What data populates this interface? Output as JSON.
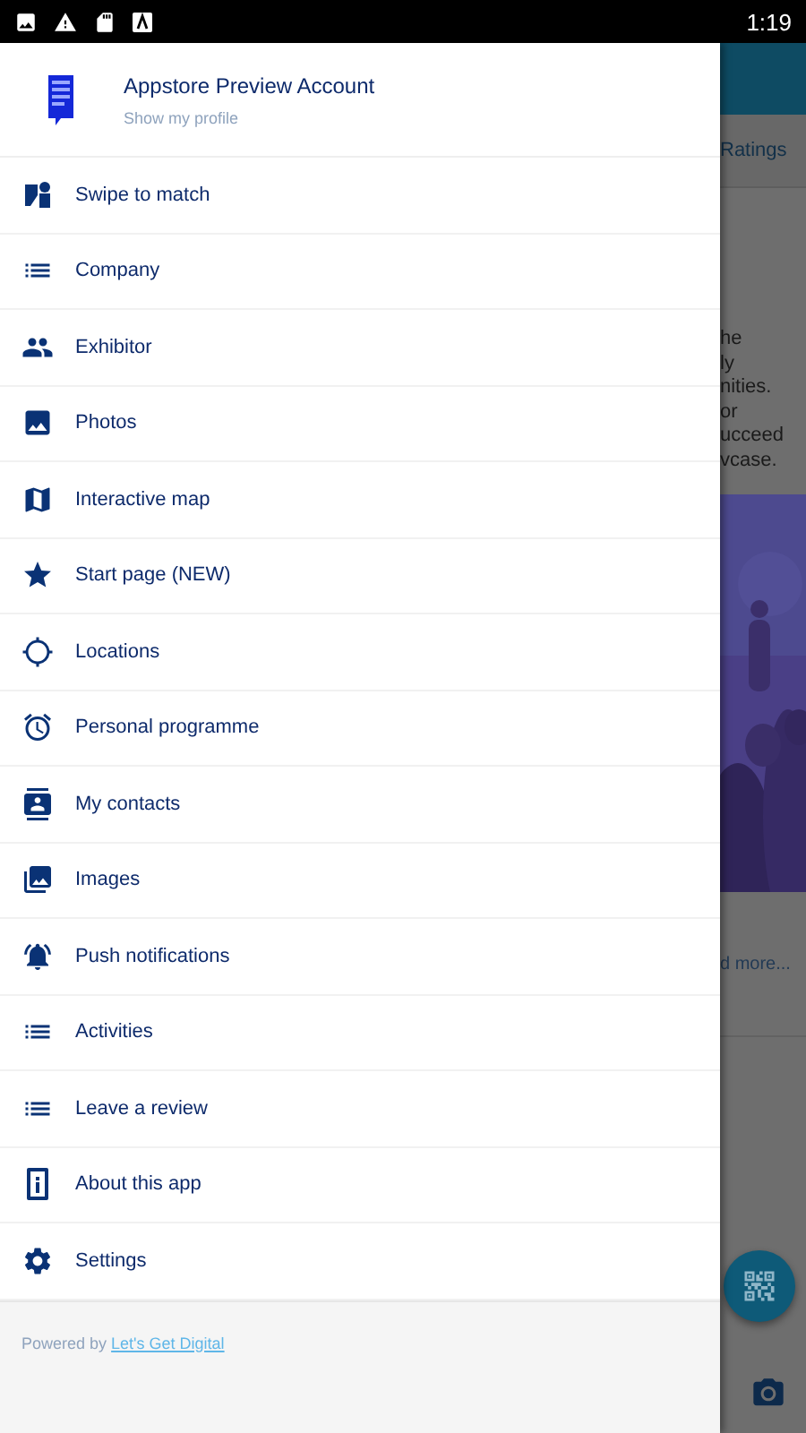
{
  "status_bar": {
    "time": "1:19"
  },
  "drawer": {
    "profile": {
      "name": "Appstore Preview Account",
      "subtitle": "Show my profile"
    },
    "menu": [
      {
        "label": "Swipe to match"
      },
      {
        "label": "Company"
      },
      {
        "label": "Exhibitor"
      },
      {
        "label": "Photos"
      },
      {
        "label": "Interactive map"
      },
      {
        "label": "Start page (NEW)"
      },
      {
        "label": "Locations"
      },
      {
        "label": "Personal programme"
      },
      {
        "label": "My contacts"
      },
      {
        "label": "Images"
      },
      {
        "label": "Push notifications"
      },
      {
        "label": "Activities"
      },
      {
        "label": "Leave a review"
      },
      {
        "label": "About this app"
      },
      {
        "label": "Settings"
      }
    ],
    "footer": {
      "text": "Powered by",
      "link": "Let's Get Digital"
    }
  },
  "background": {
    "tab": "Ratings",
    "text_lines": [
      "he",
      "ly",
      "nities.",
      "or",
      "ucceed",
      "vcase."
    ],
    "read_more": "d more..."
  }
}
